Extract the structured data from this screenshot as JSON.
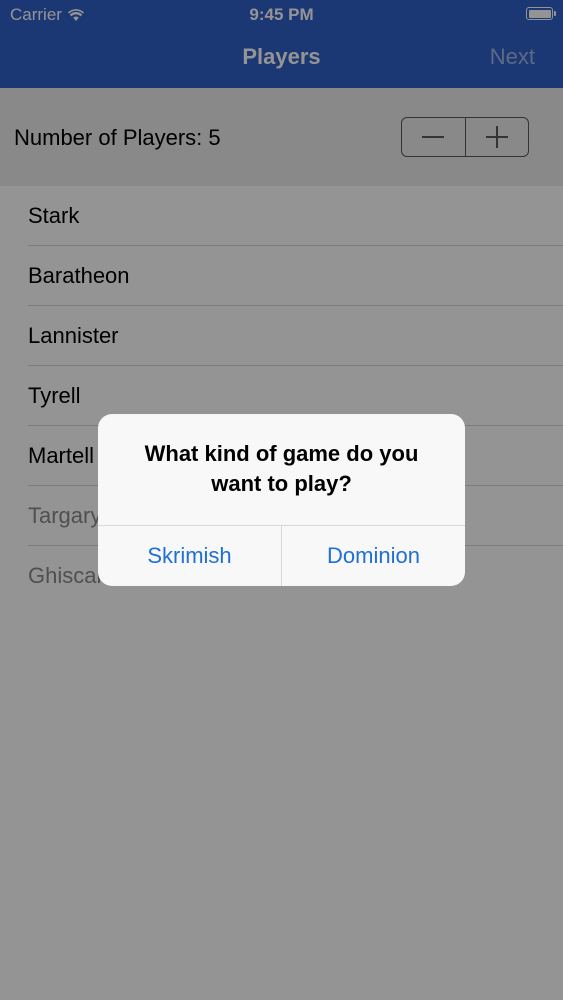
{
  "status_bar": {
    "carrier": "Carrier",
    "time": "9:45 PM"
  },
  "nav": {
    "title": "Players",
    "next_label": "Next"
  },
  "counter": {
    "label": "Number of Players:",
    "value": "5"
  },
  "houses": [
    "Stark",
    "Baratheon",
    "Lannister",
    "Tyrell",
    "Martell",
    "Targaryen",
    "Ghiscari"
  ],
  "alert": {
    "title": "What kind of game do you want to play?",
    "buttons": [
      "Skrimish",
      "Dominion"
    ]
  },
  "colors": {
    "nav_bar": "#2f5fc9",
    "alert_button": "#1f6fd6",
    "disabled_text": "#8a8a8a"
  }
}
